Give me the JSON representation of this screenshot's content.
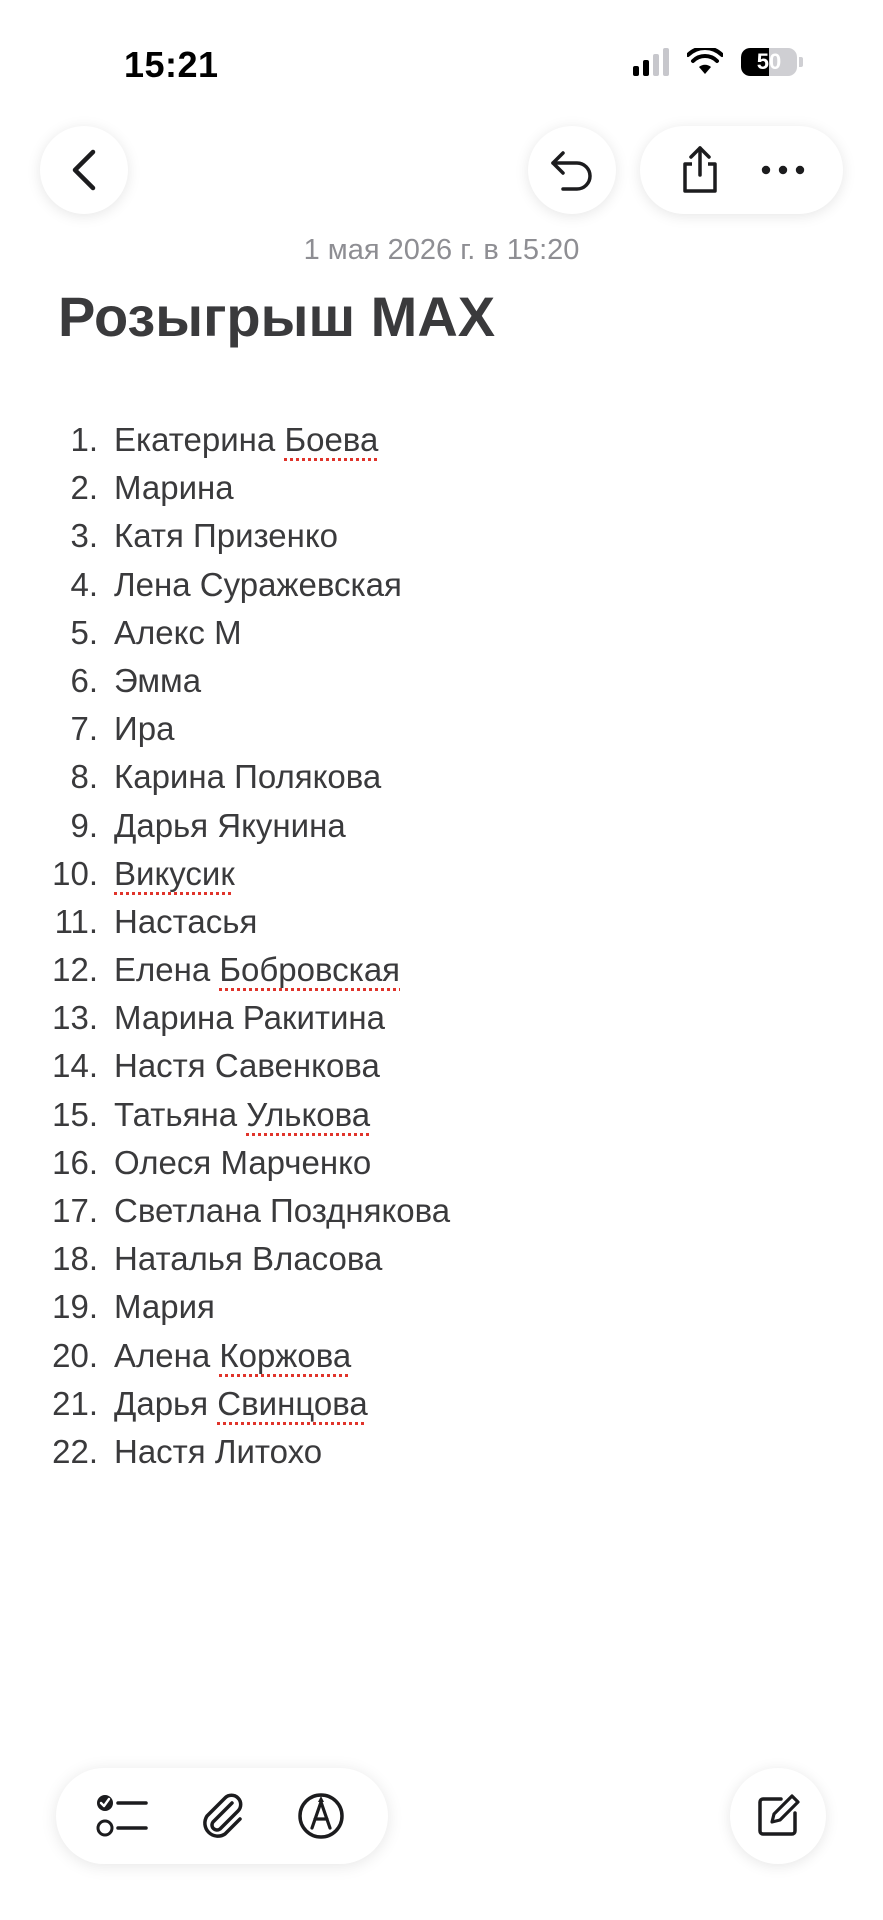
{
  "status_bar": {
    "time": "15:21",
    "battery": "50",
    "battery_level": 0.5
  },
  "nav": {
    "back_icon": "chevron-left-icon",
    "undo_icon": "undo-icon",
    "share_icon": "share-icon",
    "more_icon": "ellipsis-icon"
  },
  "note": {
    "date": "1 мая 2026 г. в 15:20",
    "title": "Розыгрыш MAX",
    "items": [
      {
        "num": "1.",
        "first": "Екатерина",
        "last": "Боева",
        "misspelled": true
      },
      {
        "num": "2.",
        "first": "Марина",
        "last": "",
        "misspelled": false
      },
      {
        "num": "3.",
        "first": "Катя",
        "last": "Призенко",
        "misspelled": false
      },
      {
        "num": "4.",
        "first": "Лена",
        "last": "Суражевская",
        "misspelled": false
      },
      {
        "num": "5.",
        "first": "Алекс",
        "last": "М",
        "misspelled": false
      },
      {
        "num": "6.",
        "first": "Эмма",
        "last": "",
        "misspelled": false
      },
      {
        "num": "7.",
        "first": "Ира",
        "last": "",
        "misspelled": false
      },
      {
        "num": "8.",
        "first": "Карина",
        "last": "Полякова",
        "misspelled": false
      },
      {
        "num": "9.",
        "first": "Дарья",
        "last": "Якунина",
        "misspelled": false
      },
      {
        "num": "10.",
        "first": "Викусик",
        "last": "",
        "misspelled_first": true
      },
      {
        "num": "11.",
        "first": "Настасья",
        "last": "",
        "misspelled": false
      },
      {
        "num": "12.",
        "first": "Елена",
        "last": "Бобровская",
        "misspelled": true
      },
      {
        "num": "13.",
        "first": "Марина",
        "last": "Ракитина",
        "misspelled": false
      },
      {
        "num": "14.",
        "first": "Настя",
        "last": "Савенкова",
        "misspelled": false
      },
      {
        "num": "15.",
        "first": "Татьяна",
        "last": "Улькова",
        "misspelled": true
      },
      {
        "num": "16.",
        "first": "Олеся",
        "last": "Марченко",
        "misspelled": false
      },
      {
        "num": "17.",
        "first": "Светлана",
        "last": "Позднякова",
        "misspelled": false
      },
      {
        "num": "18.",
        "first": "Наталья",
        "last": "Власова",
        "misspelled": false
      },
      {
        "num": "19.",
        "first": "Мария",
        "last": "",
        "misspelled": false
      },
      {
        "num": "20.",
        "first": "Алена",
        "last": "Коржова",
        "misspelled": true
      },
      {
        "num": "21.",
        "first": "Дарья",
        "last": "Свинцова",
        "misspelled": true
      },
      {
        "num": "22.",
        "first": "Настя",
        "last": "Литохо",
        "misspelled": false
      }
    ]
  },
  "toolbar": {
    "checklist_icon": "checklist-icon",
    "attach_icon": "paperclip-icon",
    "markup_icon": "pen-markup-icon",
    "compose_icon": "compose-icon"
  },
  "colors": {
    "spellcheck_underline": "#e0342b",
    "text": "#3a3a3c",
    "secondary_text": "#8e8e93"
  }
}
